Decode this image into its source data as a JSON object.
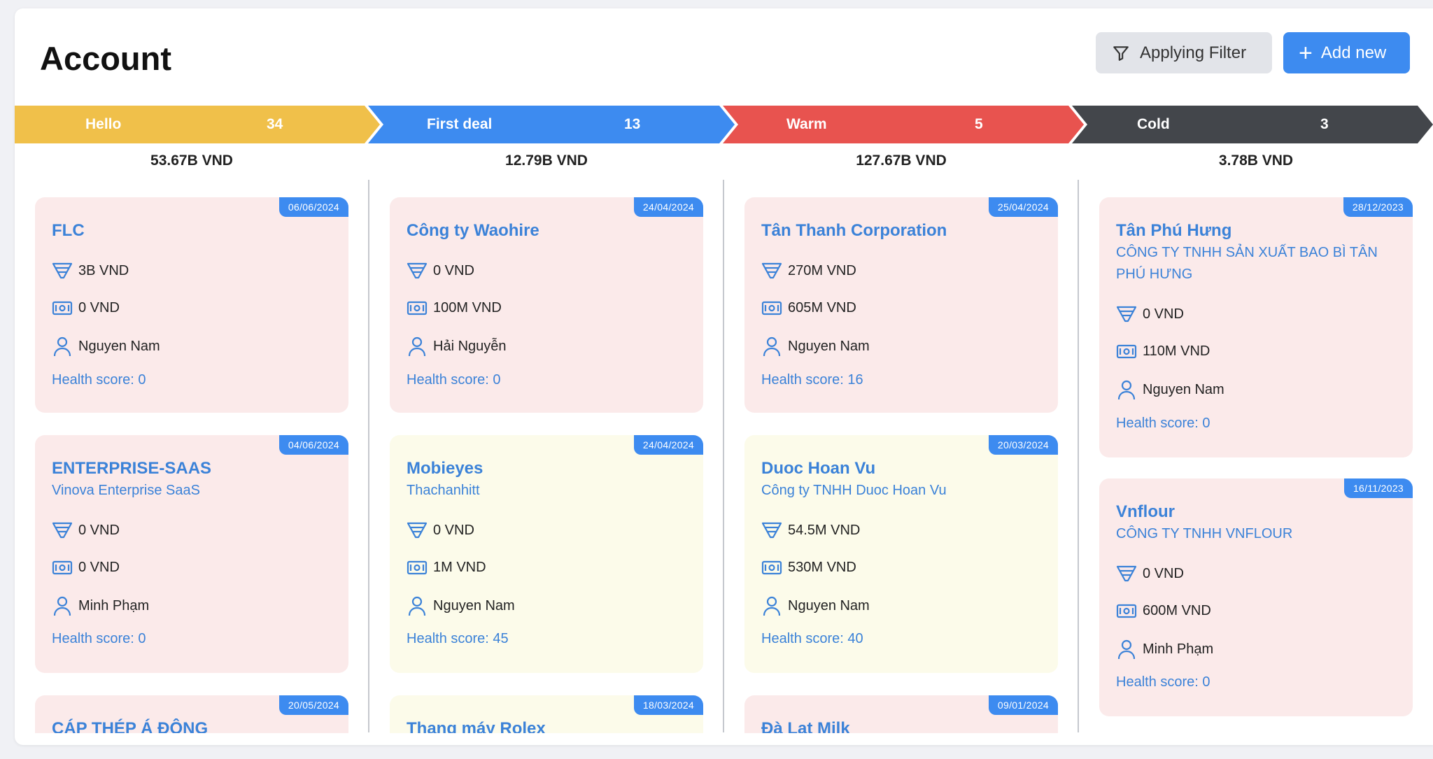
{
  "page": {
    "title": "Account",
    "filter_label": "Applying Filter",
    "add_label": "Add new"
  },
  "stages": [
    {
      "name": "Hello",
      "count": "34",
      "total": "53.67B VND",
      "color": "#f0c04a"
    },
    {
      "name": "First deal",
      "count": "13",
      "total": "12.79B VND",
      "color": "#3d8bf0"
    },
    {
      "name": "Warm",
      "count": "5",
      "total": "127.67B VND",
      "color": "#e8534f"
    },
    {
      "name": "Cold",
      "count": "3",
      "total": "3.78B VND",
      "color": "#43464b"
    }
  ],
  "columns": [
    {
      "cards": [
        {
          "date": "06/06/2024",
          "title": "FLC",
          "subtitle": "",
          "deal": "3B VND",
          "revenue": "0 VND",
          "owner": "Nguyen Nam",
          "health": "Health score: 0",
          "bg": "pink"
        },
        {
          "date": "04/06/2024",
          "title": "ENTERPRISE-SAAS",
          "subtitle": "Vinova Enterprise SaaS",
          "deal": "0 VND",
          "revenue": "0 VND",
          "owner": "Minh Phạm",
          "health": "Health score: 0",
          "bg": "pink"
        },
        {
          "date": "20/05/2024",
          "title": "CÁP THÉP Á ĐÔNG",
          "subtitle": "",
          "deal": "",
          "revenue": "",
          "owner": "",
          "health": "",
          "bg": "pink"
        }
      ]
    },
    {
      "cards": [
        {
          "date": "24/04/2024",
          "title": "Công ty Waohire",
          "subtitle": "",
          "deal": "0 VND",
          "revenue": "100M VND",
          "owner": "Hải Nguyễn",
          "health": "Health score: 0",
          "bg": "pink"
        },
        {
          "date": "24/04/2024",
          "title": "Mobieyes",
          "subtitle": "Thachanhitt",
          "deal": "0 VND",
          "revenue": "1M VND",
          "owner": "Nguyen Nam",
          "health": "Health score: 45",
          "bg": "yellow"
        },
        {
          "date": "18/03/2024",
          "title": "Thang máy Rolex",
          "subtitle": "",
          "deal": "",
          "revenue": "",
          "owner": "",
          "health": "",
          "bg": "yellow"
        }
      ]
    },
    {
      "cards": [
        {
          "date": "25/04/2024",
          "title": "Tân Thanh Corporation",
          "subtitle": "",
          "deal": "270M VND",
          "revenue": "605M VND",
          "owner": "Nguyen Nam",
          "health": "Health score: 16",
          "bg": "pink"
        },
        {
          "date": "20/03/2024",
          "title": "Duoc Hoan Vu",
          "subtitle": "Công ty TNHH Duoc Hoan Vu",
          "deal": "54.5M VND",
          "revenue": "530M VND",
          "owner": "Nguyen Nam",
          "health": "Health score: 40",
          "bg": "yellow"
        },
        {
          "date": "09/01/2024",
          "title": "Đà Lat Milk",
          "subtitle": "",
          "deal": "",
          "revenue": "",
          "owner": "",
          "health": "",
          "bg": "pink"
        }
      ]
    },
    {
      "cards": [
        {
          "date": "28/12/2023",
          "title": "Tân Phú Hưng",
          "subtitle": "CÔNG TY TNHH SẢN XUẤT BAO BÌ TÂN PHÚ HƯNG",
          "deal": "0 VND",
          "revenue": "110M VND",
          "owner": "Nguyen Nam",
          "health": "Health score: 0",
          "bg": "pink"
        },
        {
          "date": "16/11/2023",
          "title": "Vnflour",
          "subtitle": "CÔNG TY TNHH VNFLOUR",
          "deal": "0 VND",
          "revenue": "600M VND",
          "owner": "Minh Phạm",
          "health": "Health score: 0",
          "bg": "pink"
        }
      ]
    }
  ],
  "colors": {
    "accent": "#3d8bf0",
    "card_pink": "#fbeaea",
    "card_yellow": "#fcfbea"
  },
  "icons": {
    "filter": "filter-icon",
    "deal": "funnel-icon",
    "revenue": "money-icon",
    "owner": "user-icon"
  }
}
